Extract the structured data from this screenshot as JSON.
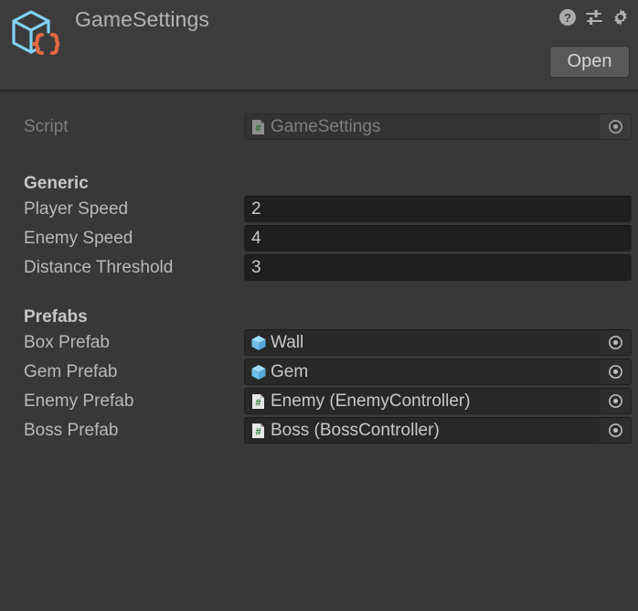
{
  "window": {
    "title": "GameSettings",
    "icon": "scriptable-object-icon",
    "background_color": "#383838",
    "header_background_color": "#3c3c3c",
    "accent_cube_color": "#7fd2f5",
    "accent_braces_color": "#e3693f"
  },
  "header": {
    "title": "GameSettings",
    "tools": [
      {
        "name": "help-icon",
        "label": "Help"
      },
      {
        "name": "preset-icon",
        "label": "Preset"
      },
      {
        "name": "gear-icon",
        "label": "Settings"
      }
    ],
    "open_button": "Open"
  },
  "script_row": {
    "label": "Script",
    "value": "GameSettings",
    "icon": "csharp-script-icon",
    "picker": "object-picker-icon",
    "disabled": true
  },
  "sections": [
    {
      "title": "Generic",
      "fields": [
        {
          "label": "Player Speed",
          "value": "2",
          "type": "number"
        },
        {
          "label": "Enemy Speed",
          "value": "4",
          "type": "number"
        },
        {
          "label": "Distance Threshold",
          "value": "3",
          "type": "number"
        }
      ]
    },
    {
      "title": "Prefabs",
      "fields": [
        {
          "label": "Box Prefab",
          "value": "Wall",
          "type": "object",
          "icon": "prefab-cube-icon"
        },
        {
          "label": "Gem Prefab",
          "value": "Gem",
          "type": "object",
          "icon": "prefab-cube-icon"
        },
        {
          "label": "Enemy Prefab",
          "value": "Enemy (EnemyController)",
          "type": "object",
          "icon": "csharp-script-icon"
        },
        {
          "label": "Boss Prefab",
          "value": "Boss (BossController)",
          "type": "object",
          "icon": "csharp-script-icon"
        }
      ]
    }
  ]
}
